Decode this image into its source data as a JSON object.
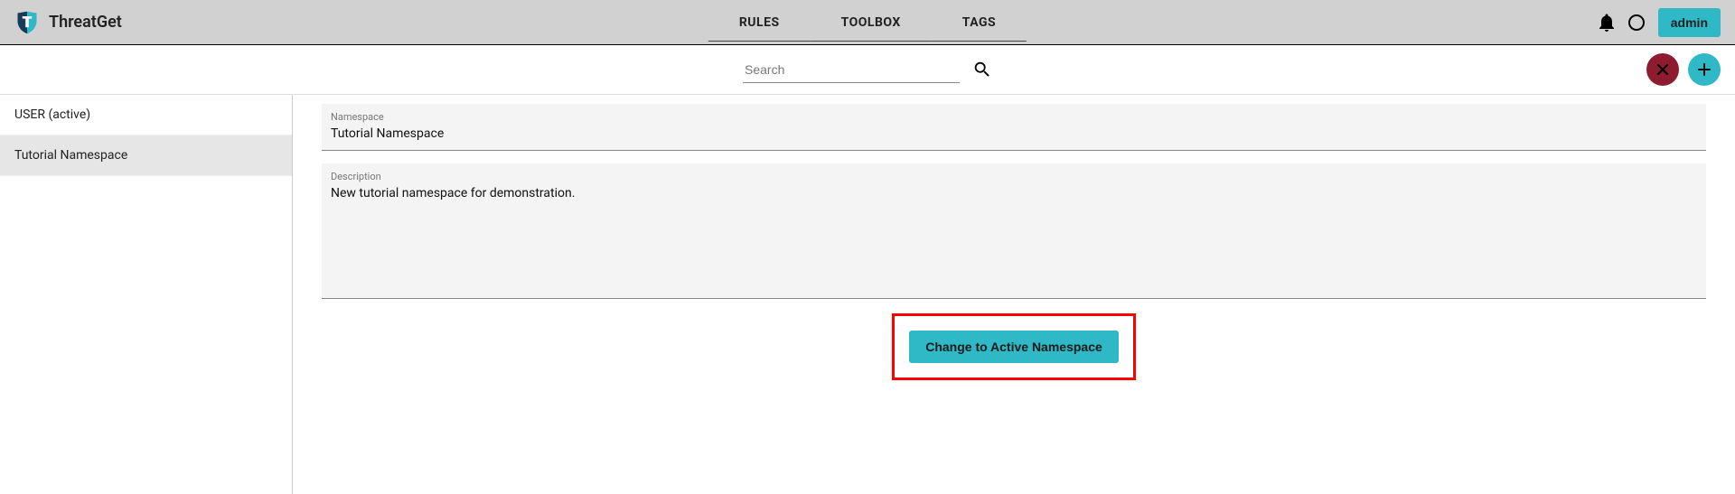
{
  "app": {
    "name": "ThreatGet"
  },
  "nav": {
    "tabs": [
      "RULES",
      "TOOLBOX",
      "TAGS"
    ]
  },
  "header": {
    "admin_label": "admin"
  },
  "search": {
    "placeholder": "Search"
  },
  "sidebar": {
    "items": [
      {
        "label": "USER (active)",
        "selected": false
      },
      {
        "label": "Tutorial Namespace",
        "selected": true
      }
    ]
  },
  "detail": {
    "namespace_label": "Namespace",
    "namespace_value": "Tutorial Namespace",
    "description_label": "Description",
    "description_value": "New tutorial namespace for demonstration.",
    "change_button_label": "Change to Active Namespace"
  }
}
